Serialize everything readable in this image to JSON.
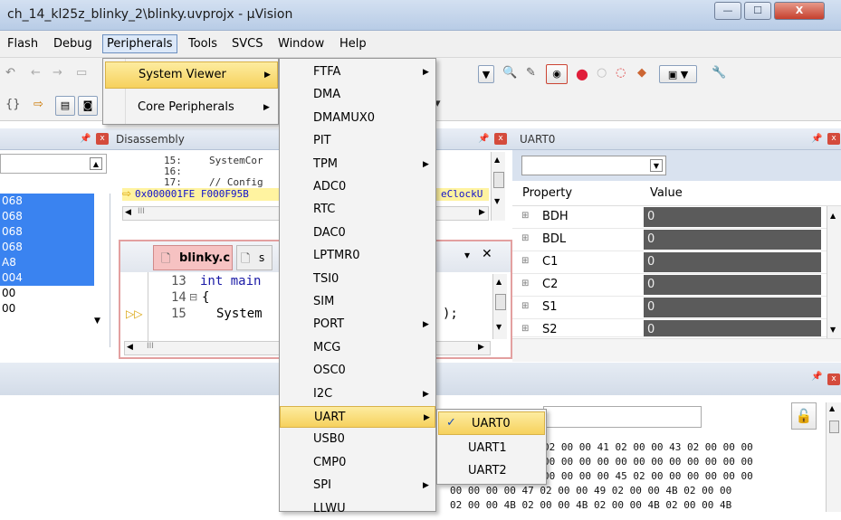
{
  "window": {
    "title": "ch_14_kl25z_blinky_2\\blinky.uvprojx - µVision",
    "minimize": "—",
    "maximize": "☐",
    "close": "X"
  },
  "menubar": [
    "Flash",
    "Debug",
    "Peripherals",
    "Tools",
    "SVCS",
    "Window",
    "Help"
  ],
  "peripherals_menu": {
    "items": [
      {
        "label": "System Viewer"
      },
      {
        "label": "Core Peripherals"
      }
    ]
  },
  "system_viewer_menu": {
    "items": [
      "FTFA",
      "DMA",
      "DMAMUX0",
      "PIT",
      "TPM",
      "ADC0",
      "RTC",
      "DAC0",
      "LPTMR0",
      "TSI0",
      "SIM",
      "PORT",
      "MCG",
      "OSC0",
      "I2C",
      "UART",
      "USB0",
      "CMP0",
      "SPI",
      "LLWU"
    ]
  },
  "uart_menu": {
    "items": [
      "UART0",
      "UART1",
      "UART2"
    ],
    "checked": "UART0",
    "check_mark": "✓"
  },
  "left_pane": {
    "registers": [
      "068",
      "068",
      "068",
      "068",
      "A8",
      "004",
      "00",
      "00"
    ]
  },
  "disassembly": {
    "title": "Disassembly",
    "lines": [
      {
        "num": "15:",
        "code": "SystemCor"
      },
      {
        "num": "16:",
        "code": ""
      },
      {
        "num": "17:",
        "code": "// Config"
      }
    ],
    "current_line": "0x000001FE F000F95B",
    "current_line_tail": "eClockU",
    "scroll_thumb": "III"
  },
  "editor": {
    "tab_active": "blinky.c",
    "tab_other": "s",
    "lines": [
      {
        "num": "13",
        "code": "int main"
      },
      {
        "num": "14",
        "code": "{"
      },
      {
        "num": "15",
        "code": "System"
      }
    ],
    "line_tail": ");",
    "scroll_thumb": "III"
  },
  "uart_pane": {
    "title": "UART0",
    "col_property": "Property",
    "col_value": "Value",
    "rows": [
      {
        "name": "BDH",
        "value": "0"
      },
      {
        "name": "BDL",
        "value": "0"
      },
      {
        "name": "C1",
        "value": "0"
      },
      {
        "name": "C2",
        "value": "0"
      },
      {
        "name": "S1",
        "value": "0"
      },
      {
        "name": "S2",
        "value": "0"
      }
    ]
  },
  "memory": {
    "hex_lines": [
      "02 00 00 41 02 00 00 43 02 00 00 00",
      "00 00 00 00 00 00 00 00 00 00 00 00",
      "00 00 00 00 45 02 00 00 00 00 00 00",
      "00 00 00 00 47 02 00 00 49 02 00 00 4B 02 00 00",
      "02 00 00 4B 02 00 00 4B 02 00 00 4B 02 00 00 4B"
    ]
  },
  "colors": {
    "selection_blue": "#3a83f0",
    "menu_highlight": "#f6d15d",
    "value_cell": "#5b5b5b"
  }
}
